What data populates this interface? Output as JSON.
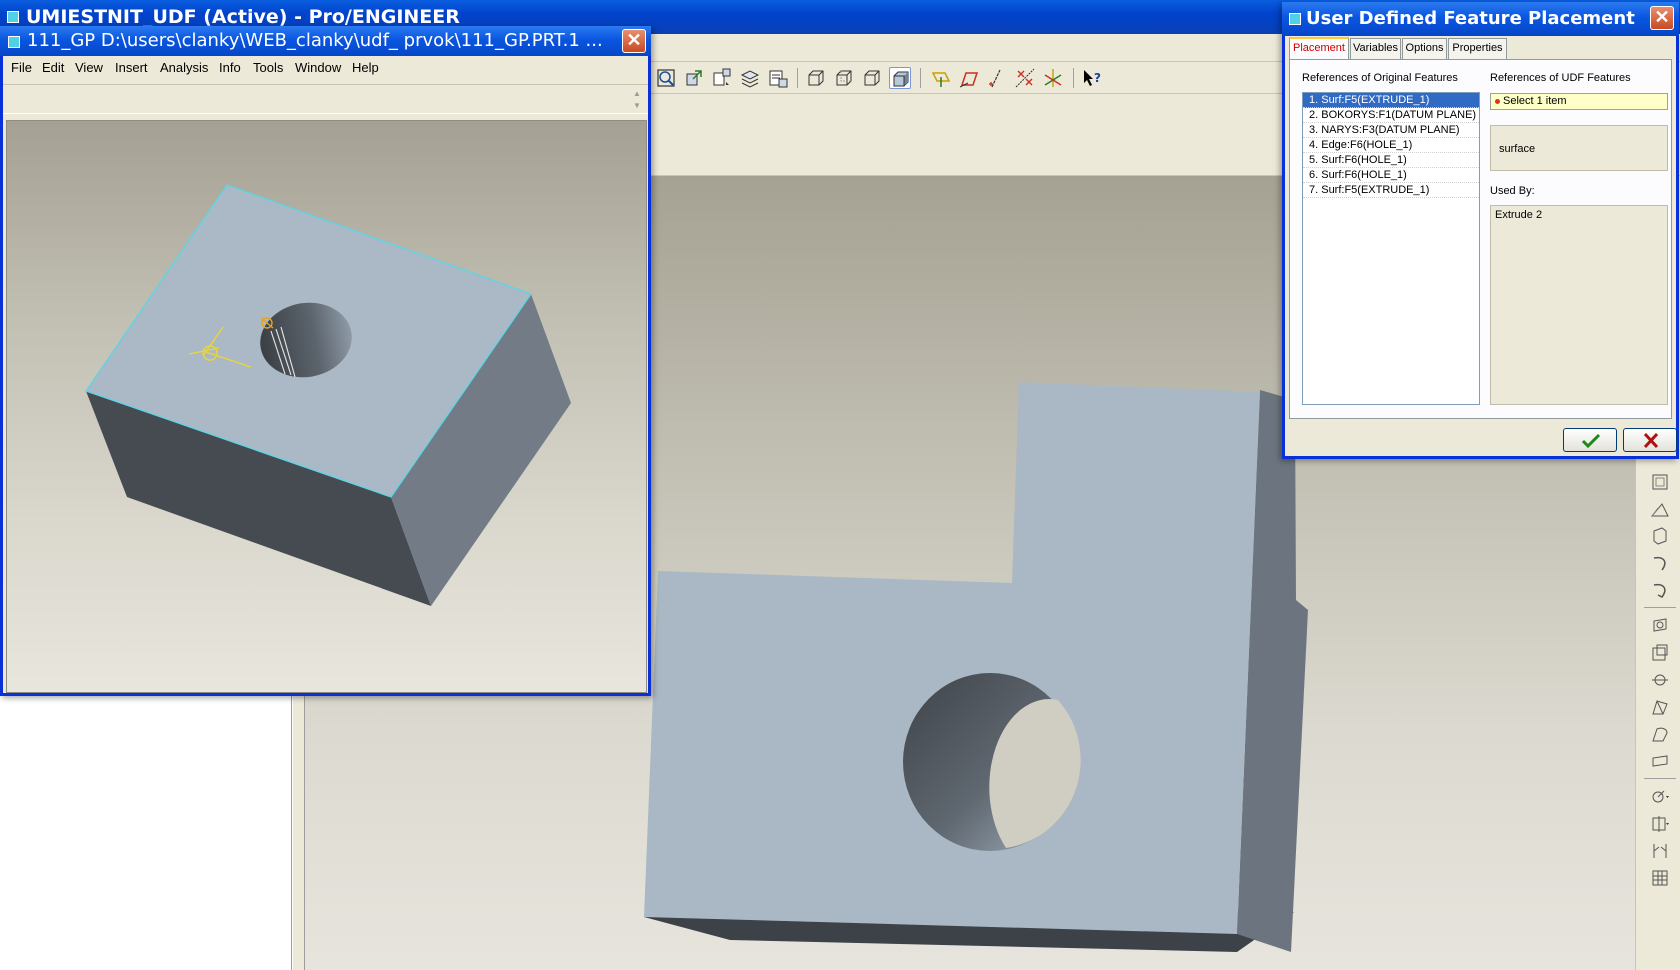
{
  "main_window": {
    "title": "UMIESTNIT_UDF (Active) - Pro/ENGINEER"
  },
  "sub_window": {
    "title": "111_GP D:\\users\\clanky\\WEB_clanky\\udf_ prvok\\111_GP.PRT.1 ...",
    "menu": [
      "File",
      "Edit",
      "View",
      "Insert",
      "Analysis",
      "Info",
      "Tools",
      "Window",
      "Help"
    ]
  },
  "udf_dialog": {
    "title": "User Defined Feature Placement",
    "tabs": [
      "Placement",
      "Variables",
      "Options",
      "Properties"
    ],
    "active_tab": "Placement",
    "orig_header": "References of Original Features",
    "orig_items": [
      "1. Surf:F5(EXTRUDE_1)",
      "2. BOKORYS:F1(DATUM PLANE)",
      "3. NARYS:F3(DATUM PLANE)",
      "4. Edge:F6(HOLE_1)",
      "5. Surf:F6(HOLE_1)",
      "6. Surf:F6(HOLE_1)",
      "7. Surf:F5(EXTRUDE_1)"
    ],
    "selected_index": 0,
    "udf_header": "References of UDF Features",
    "select_placeholder": "Select 1 item",
    "reference_type": "surface",
    "used_by_label": "Used By:",
    "used_by_value": "Extrude 2"
  },
  "toolbar_icons": [
    "zoom-fit-icon",
    "orient-icon",
    "saved-views-icon",
    "layers-icon",
    "view-manager-icon",
    "wireframe-icon",
    "hidden-line-icon",
    "no-hidden-icon",
    "shading-icon",
    "datum-planes-icon",
    "datum-axes-icon",
    "datum-points-icon",
    "coordinate-systems-icon",
    "spin-center-icon",
    "context-help-icon"
  ],
  "colors": {
    "title_blue": "#0a56e0",
    "selection_blue": "#316ac5",
    "part_face_light": "#a9b8c4",
    "part_face_dark": "#4b5259",
    "edge_highlight": "#5ad6e8",
    "active_tab_text": "#cc0000",
    "select_field_bg": "#ffffc8"
  }
}
